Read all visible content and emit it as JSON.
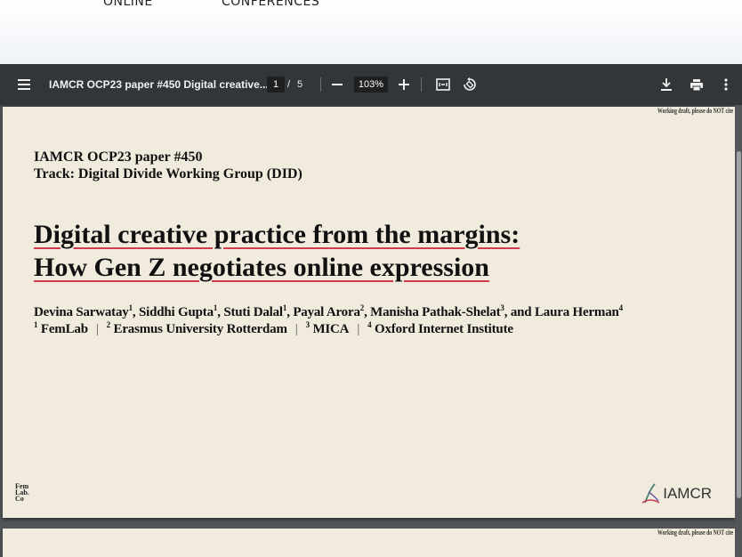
{
  "site_nav": {
    "links": [
      "ONLINE",
      "CONFERENCES"
    ]
  },
  "pdf_viewer": {
    "doc_title": "IAMCR OCP23 paper #450 Digital creative...",
    "current_page": "1",
    "page_separator": "/",
    "total_pages": "5",
    "zoom": "103%",
    "icons": [
      "menu-icon",
      "zoom-out-icon",
      "zoom-in-icon",
      "fit-page-icon",
      "rotate-icon",
      "download-icon",
      "print-icon",
      "more-options-icon"
    ]
  },
  "page1": {
    "draft_note": "Working draft, please do NOT cite",
    "paper_id": "IAMCR OCP23 paper #450",
    "track": "Track: Digital Divide Working Group (DID)",
    "title_line1": "Digital creative practice from the margins:",
    "title_line2": "How Gen Z negotiates online expression",
    "authors": [
      {
        "name": "Devina Sarwatay",
        "aff": "1",
        "sep": ", "
      },
      {
        "name": "Siddhi Gupta",
        "aff": "1",
        "sep": ", "
      },
      {
        "name": "Stuti Dalal",
        "aff": "1",
        "sep": ", "
      },
      {
        "name": "Payal Arora",
        "aff": "2",
        "sep": ", "
      },
      {
        "name": "Manisha Pathak-Shelat",
        "aff": "3",
        "sep": ", and "
      },
      {
        "name": "Laura Herman",
        "aff": "4",
        "sep": ""
      }
    ],
    "affiliations": [
      {
        "num": "1",
        "name": "FemLab"
      },
      {
        "num": "2",
        "name": "Erasmus University Rotterdam"
      },
      {
        "num": "3",
        "name": "MICA"
      },
      {
        "num": "4",
        "name": "Oxford Internet Institute"
      }
    ],
    "footer_left_logo": "Fem Lab. Co",
    "footer_right_logo": "IAMCR"
  },
  "page2": {
    "draft_note": "Working draft, please do NOT cite"
  },
  "colors": {
    "toolbar": "#323639",
    "viewer_bg": "#525659",
    "page_bg": "#f1ebde",
    "title_underline": "#d23b4b"
  }
}
